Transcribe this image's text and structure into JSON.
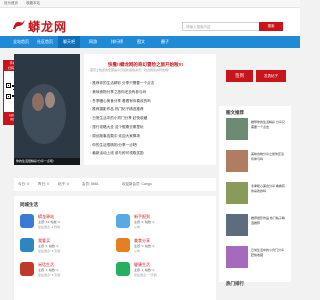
{
  "topbar": {
    "left1": "设为首页",
    "left2": "收藏本站",
    "right": "|"
  },
  "header": {
    "logo": "蟒龙网",
    "search_placeholder": "请输入搜索内容",
    "search_button": "搜索"
  },
  "nav": [
    "全站首页",
    "社区首页",
    "聊天吧",
    "网游",
    "排行榜",
    "图文",
    "圈子"
  ],
  "nav_active_index": 2,
  "left_ad": {
    "top": "手机版\n扫码访问",
    "bottom": "扫码关注\n蟒龙网"
  },
  "slider": {
    "caption": "你的生活很精彩!分享一点吧!"
  },
  "news": {
    "headline": "快看!!蟒龙网的奇幻冒险之旅开始啦!!!",
    "subline": "首页上热点的全部是今日最新最热资讯，欢迎阅读并转发哦!",
    "items": [
      "推荐你的生活精彩 分享只需要一个点击",
      "美味食物分享之旅你还没有参与吗",
      "冬季暖心美食分享 看看有你喜欢的吗",
      "推荐摄影作品 热门帖子精选推荐",
      "日常生活中的小窍门分享 赶快收藏",
      "旅行攻略大全 这个假期去哪里玩",
      "原创故事连载中 欢迎大家捧场",
      "你的生活很精彩!分享一点吧!",
      "最新活动上线 参与即可领取奖励"
    ]
  },
  "sidebar": {
    "sign_label": "签到",
    "post_label": "发表帖子",
    "section1": "图文推荐",
    "posts": [
      {
        "text": "推荐你的生活精彩 分享只需要一个点击"
      },
      {
        "text": "美味食物分享之旅你还没有参与吗"
      },
      {
        "text": "冬季暖心美食分享 看看有你喜欢的吗"
      },
      {
        "text": "推荐摄影作品 热门帖子精选推荐"
      },
      {
        "text": "日常生活中的小窍门分享 赶快收藏"
      }
    ],
    "section2": "热门排行"
  },
  "stats": [
    "今日: 0",
    "昨日: 0",
    "帖子: 4",
    "会员: 8661",
    "欢迎新会员: Cango"
  ],
  "zone": {
    "title": "同城生活",
    "forums": [
      {
        "name": "蟒龙驿站",
        "meta": "主题: 13, 帖数: 0",
        "last": "最后发表: 2 秒前",
        "color": "#3a7bd5"
      },
      {
        "name": "新手报到",
        "meta": "主题: 0, 帖数: 0",
        "last": "从未",
        "color": "#5aa9e6"
      },
      {
        "name": "我要买",
        "meta": "主题: 5, 帖数: 0",
        "last": "最后发表: 5 天前",
        "color": "#2e86c1"
      },
      {
        "name": "美食分享",
        "meta": "主题: 0, 帖数: 0",
        "last": "从未",
        "color": "#e67e22"
      },
      {
        "name": "闲话生活",
        "meta": "主题: 2, 帖数: 0",
        "last": "最后发表: 5 天前",
        "color": "#c0392b"
      },
      {
        "name": "健康生活",
        "meta": "主题: 1, 帖数: 0",
        "last": "最后发表: 一天前",
        "color": "#27ae60"
      }
    ]
  }
}
